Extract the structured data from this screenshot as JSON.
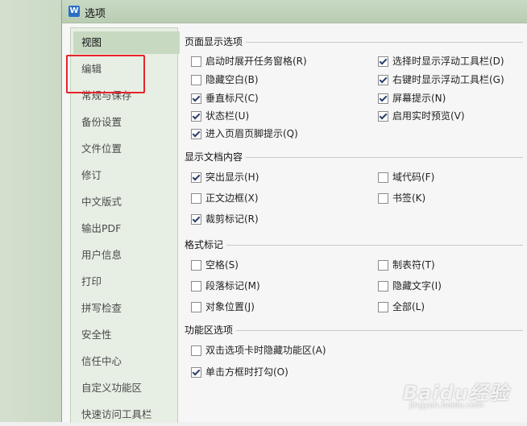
{
  "window": {
    "title": "选项",
    "icon": "wps-writer-icon"
  },
  "sidebar": {
    "items": [
      {
        "label": "视图",
        "active": true
      },
      {
        "label": "编辑",
        "active": false
      },
      {
        "label": "常规与保存",
        "active": false
      },
      {
        "label": "备份设置",
        "active": false
      },
      {
        "label": "文件位置",
        "active": false
      },
      {
        "label": "修订",
        "active": false
      },
      {
        "label": "中文版式",
        "active": false
      },
      {
        "label": "输出PDF",
        "active": false
      },
      {
        "label": "用户信息",
        "active": false
      },
      {
        "label": "打印",
        "active": false
      },
      {
        "label": "拼写检查",
        "active": false
      },
      {
        "label": "安全性",
        "active": false
      },
      {
        "label": "信任中心",
        "active": false
      },
      {
        "label": "自定义功能区",
        "active": false
      },
      {
        "label": "快速访问工具栏",
        "active": false
      }
    ]
  },
  "groups": [
    {
      "title": "页面显示选项",
      "options": [
        {
          "label": "启动时展开任务窗格(R)",
          "checked": false
        },
        {
          "label": "选择时显示浮动工具栏(D)",
          "checked": true
        },
        {
          "label": "隐藏空白(B)",
          "checked": false
        },
        {
          "label": "右键时显示浮动工具栏(G)",
          "checked": true
        },
        {
          "label": "垂直标尺(C)",
          "checked": true
        },
        {
          "label": "屏幕提示(N)",
          "checked": true
        },
        {
          "label": "状态栏(U)",
          "checked": true
        },
        {
          "label": "启用实时预览(V)",
          "checked": true
        },
        {
          "label": "进入页眉页脚提示(Q)",
          "checked": true
        }
      ]
    },
    {
      "title": "显示文档内容",
      "options": [
        {
          "label": "突出显示(H)",
          "checked": true
        },
        {
          "label": "域代码(F)",
          "checked": false
        },
        {
          "label": "正文边框(X)",
          "checked": false
        },
        {
          "label": "书签(K)",
          "checked": false
        },
        {
          "label": "裁剪标记(R)",
          "checked": true
        }
      ]
    },
    {
      "title": "格式标记",
      "options": [
        {
          "label": "空格(S)",
          "checked": false
        },
        {
          "label": "制表符(T)",
          "checked": false
        },
        {
          "label": "段落标记(M)",
          "checked": false
        },
        {
          "label": "隐藏文字(I)",
          "checked": false
        },
        {
          "label": "对象位置(J)",
          "checked": false
        },
        {
          "label": "全部(L)",
          "checked": false
        }
      ]
    },
    {
      "title": "功能区选项",
      "options": [
        {
          "label": "双击选项卡时隐藏功能区(A)",
          "checked": false
        },
        {
          "label": "单击方框时打勾(O)",
          "checked": true
        }
      ]
    }
  ],
  "watermark": {
    "main": "Baidu经验",
    "sub": "jingyan.baidu.com"
  },
  "colors": {
    "highlight": "#e8232a",
    "checkmark": "#2b3d6e",
    "sidebar_active": "#c8d9c2"
  }
}
